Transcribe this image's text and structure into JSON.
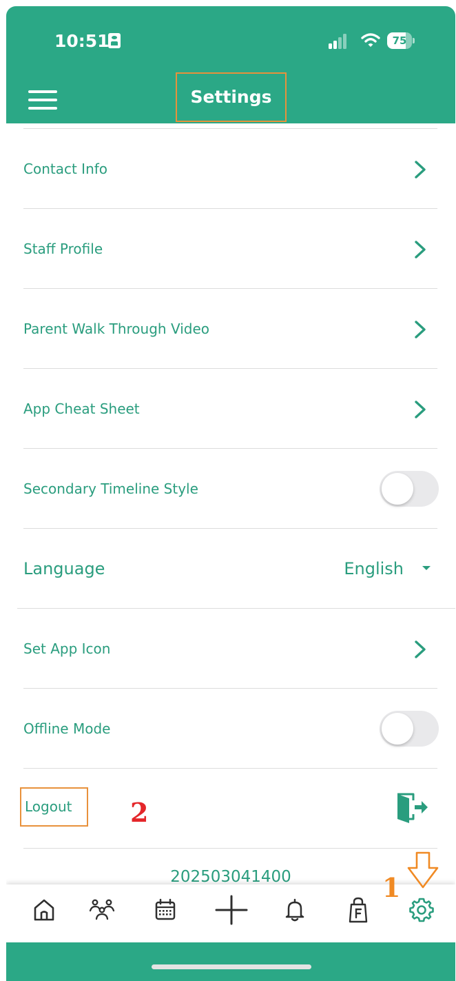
{
  "status_bar": {
    "time": "10:51",
    "battery": "75",
    "battery_level_percent": 75
  },
  "header": {
    "title": "Settings",
    "menu_icon": "hamburger-menu-icon",
    "background_color": "#2ba886"
  },
  "settings": {
    "contact_info": "Contact Info",
    "staff_profile": "Staff Profile",
    "parent_walk_through_video": "Parent Walk Through Video",
    "app_cheat_sheet": "App Cheat Sheet",
    "secondary_timeline_style": "Secondary Timeline Style",
    "secondary_timeline_style_on": false,
    "language_label": "Language",
    "language_value": "English",
    "set_app_icon": "Set App Icon",
    "offline_mode": "Offline Mode",
    "offline_mode_on": false,
    "logout": "Logout"
  },
  "version": "202503041400",
  "annotations": {
    "step_1": "1",
    "step_2": "2",
    "highlight_color": "#e8913b"
  },
  "tab_bar": {
    "items": [
      "home-icon",
      "people-icon",
      "calendar-icon",
      "plus-icon",
      "bell-icon",
      "f-bag-icon",
      "gear-icon"
    ],
    "active": "gear-icon"
  },
  "colors": {
    "accent": "#2ba886",
    "text": "#2a9d7e",
    "tab_icon": "#2f2f2f"
  }
}
